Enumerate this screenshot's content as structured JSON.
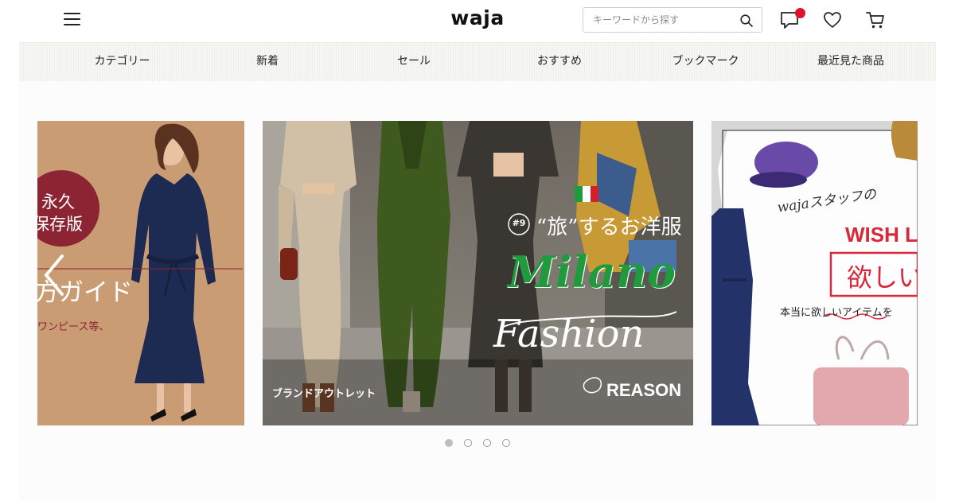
{
  "header": {
    "logo": "waja",
    "search_placeholder": "キーワードから探す"
  },
  "nav": {
    "items": [
      "カテゴリー",
      "新着",
      "セール",
      "おすすめ",
      "ブックマーク",
      "最近見た商品"
    ]
  },
  "carousel": {
    "left_card": {
      "badge_line1": "永久",
      "badge_line2": "保存版",
      "title": "方ガイド",
      "subtitle": "ワンピース等、"
    },
    "center_card": {
      "number": "#9",
      "headline": "“旅”するお洋服",
      "script_word1": "Milano",
      "script_word2": "Fashion",
      "caption": "ブランドアウトレット",
      "brand": "REASON"
    },
    "right_card": {
      "script_line": "wajaスタッフの",
      "wish_title": "WISH L",
      "boxed_text": "欲しい",
      "bottom_line": "本当に欲しいアイテムを"
    },
    "dots": [
      true,
      false,
      false,
      false
    ]
  },
  "colors": {
    "accent_red": "#e0112c",
    "badge_maroon": "#8c2434",
    "left_card_bg": "#c79a72",
    "dress_navy": "#1d2b52"
  }
}
